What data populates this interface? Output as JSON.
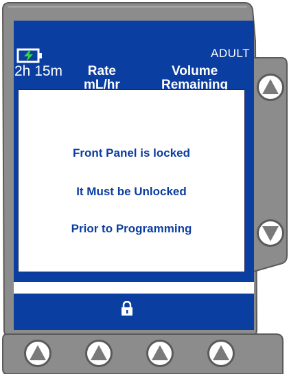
{
  "status_bar": {
    "battery_icon": "battery-charging-icon",
    "battery_time": "2h 15m",
    "patient_mode": "ADULT"
  },
  "columns": {
    "rate_line1": "Rate",
    "rate_line2": "mL/hr",
    "volume_line1": "Volume",
    "volume_line2": "Remaining"
  },
  "dialog": {
    "line1": "Front Panel is locked",
    "line2": "It Must be Unlocked",
    "line3": "Prior to Programming"
  },
  "footer": {
    "lock_icon": "lock-icon"
  },
  "buttons": {
    "side": [
      "up-arrow-icon",
      "down-arrow-icon"
    ],
    "bottom": [
      "up-arrow-icon",
      "up-arrow-icon",
      "up-arrow-icon",
      "up-arrow-icon"
    ]
  },
  "colors": {
    "screen_bg": "#0b3ea1",
    "bezel": "#8c8c8c",
    "dialog_text": "#0b3ea1"
  }
}
